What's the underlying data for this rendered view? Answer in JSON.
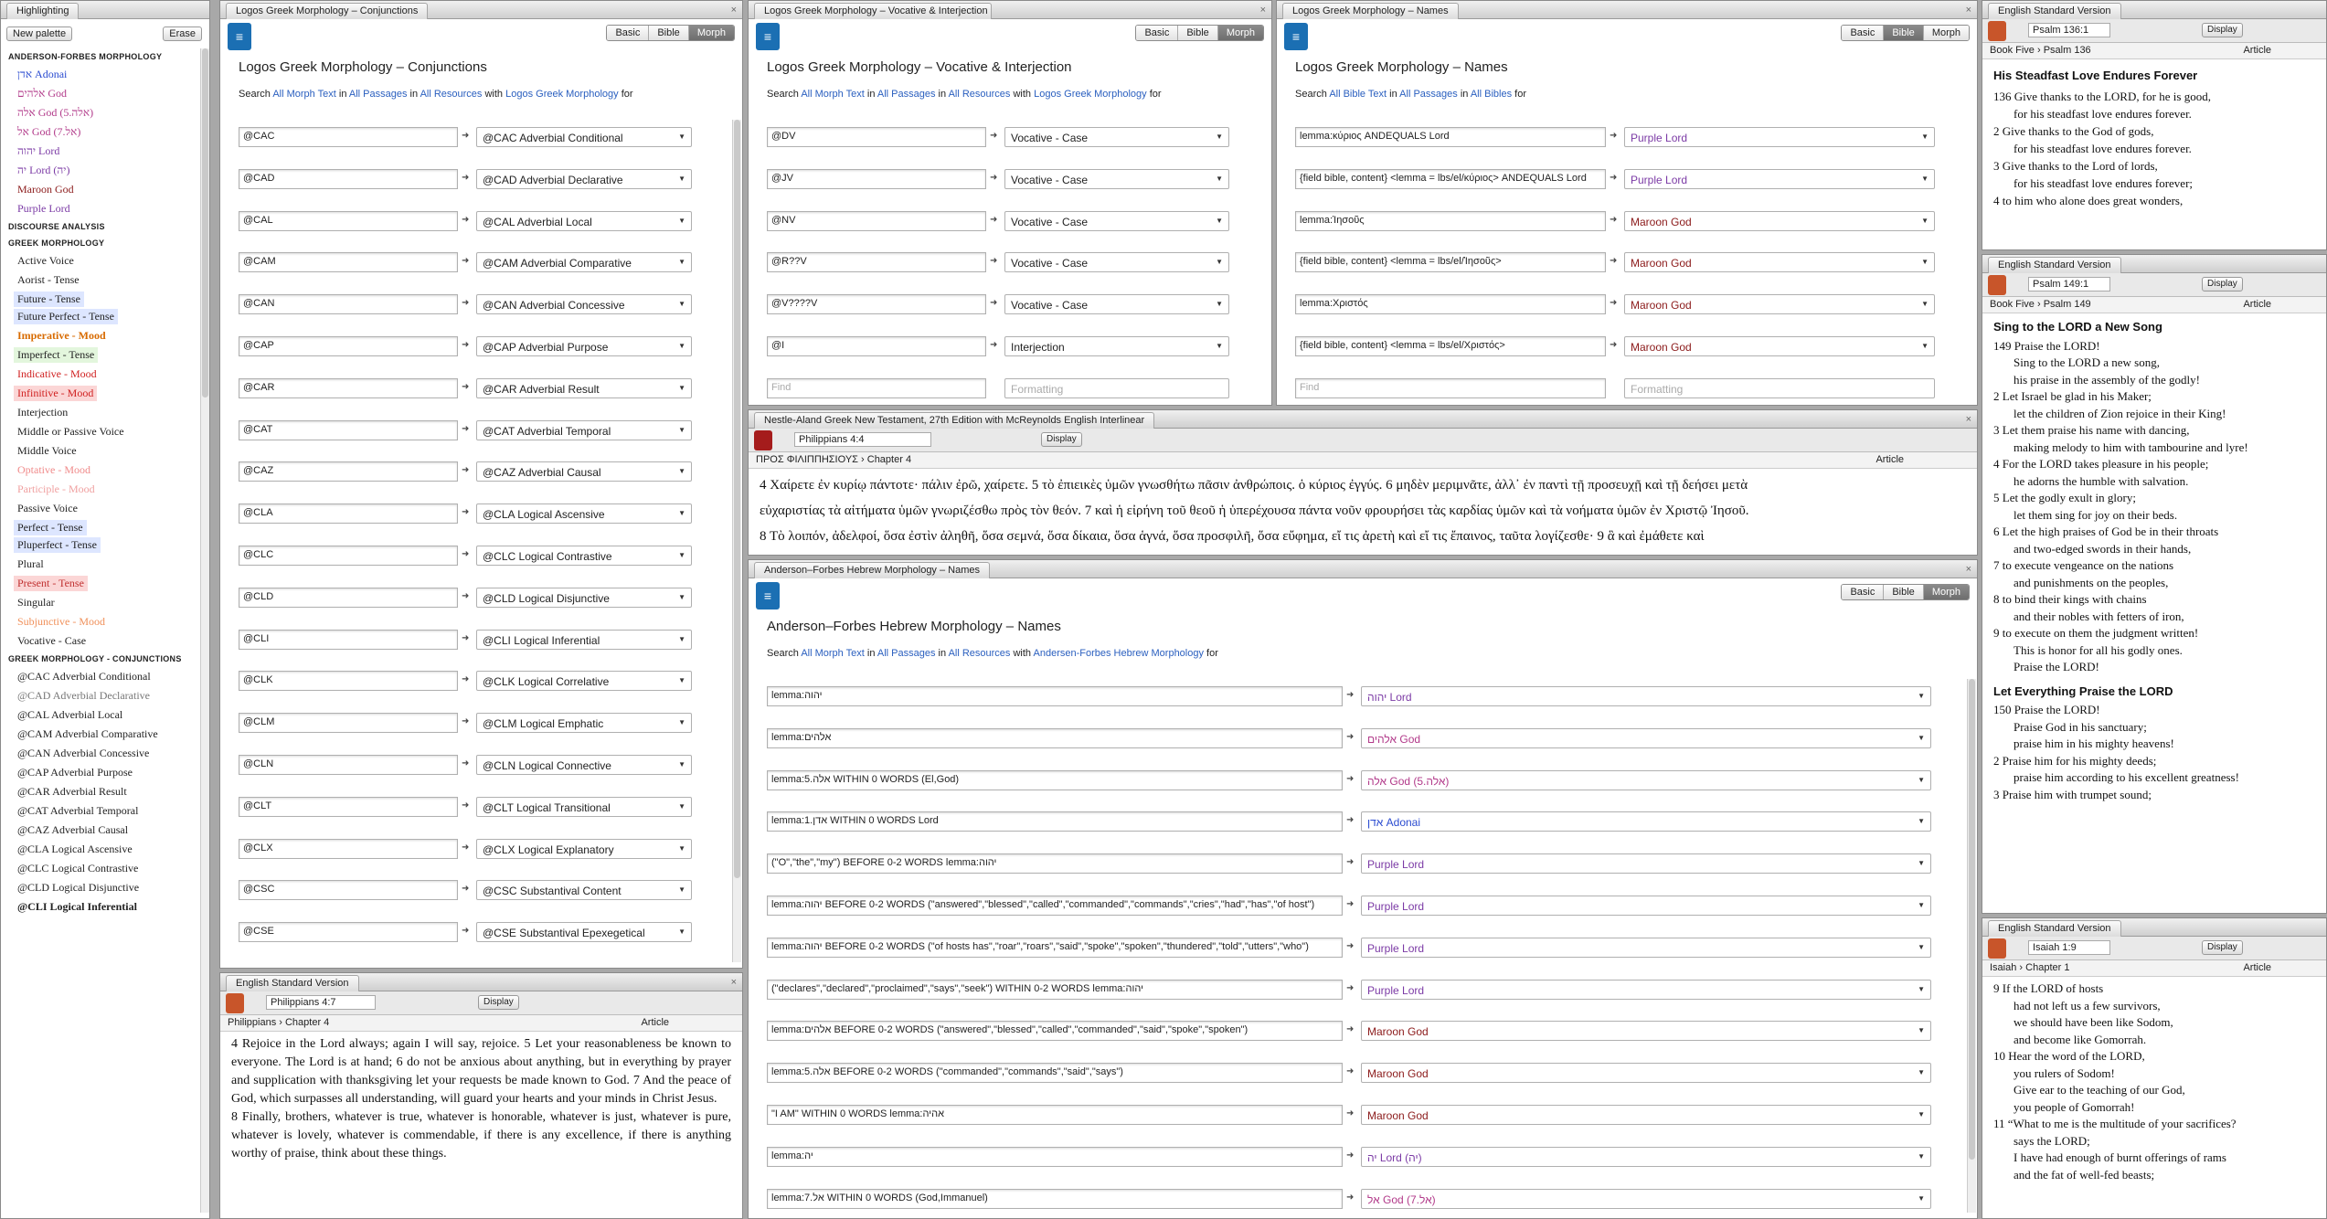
{
  "sidebar": {
    "title": "Highlighting",
    "new_btn": "New palette",
    "erase_btn": "Erase",
    "sections": [
      {
        "head": "ANDERSON-FORBES MORPHOLOGY",
        "items": [
          {
            "t": "אדן Adonai",
            "c": "#2a4bd0"
          },
          {
            "t": "אלהים God",
            "c": "#b23a8a"
          },
          {
            "t": "אלה God (5.אלה)",
            "c": "#b23a8a"
          },
          {
            "t": "אל God (7.אל)",
            "c": "#b23a8a"
          },
          {
            "t": "יהוה Lord",
            "c": "#7b3aa5"
          },
          {
            "t": "יה Lord (יה)",
            "c": "#7b3aa5"
          },
          {
            "t": "Maroon God",
            "c": "#8b1a1a"
          },
          {
            "t": "Purple Lord",
            "c": "#7b3aa5"
          }
        ]
      },
      {
        "head": "DISCOURSE ANALYSIS",
        "items": []
      },
      {
        "head": "GREEK MORPHOLOGY",
        "items": [
          {
            "t": "Active Voice",
            "c": "#222"
          },
          {
            "t": "Aorist - Tense",
            "c": "#222"
          },
          {
            "t": "Future - Tense",
            "c": "#222",
            "bg": "#dde6ff"
          },
          {
            "t": "Future Perfect - Tense",
            "c": "#222",
            "bg": "#dde6ff"
          },
          {
            "t": "Imperative - Mood",
            "c": "#d86b00",
            "b": true
          },
          {
            "t": "Imperfect - Tense",
            "c": "#222",
            "bg": "#e3f6dd"
          },
          {
            "t": "Indicative - Mood",
            "c": "#d02020"
          },
          {
            "t": "Infinitive - Mood",
            "c": "#d02020",
            "bg": "#fbd6d6"
          },
          {
            "t": "Interjection",
            "c": "#222"
          },
          {
            "t": "Middle or Passive Voice",
            "c": "#222"
          },
          {
            "t": "Middle Voice",
            "c": "#222"
          },
          {
            "t": "Optative - Mood",
            "c": "#f08a8a"
          },
          {
            "t": "Participle - Mood",
            "c": "#f0a0a0"
          },
          {
            "t": "Passive Voice",
            "c": "#222"
          },
          {
            "t": "Perfect - Tense",
            "c": "#222",
            "bg": "#dde6ff"
          },
          {
            "t": "Pluperfect - Tense",
            "c": "#222",
            "bg": "#dde6ff"
          },
          {
            "t": "Plural",
            "c": "#222"
          },
          {
            "t": "Present - Tense",
            "c": "#c03030",
            "bg": "#fbd6d6"
          },
          {
            "t": "Singular",
            "c": "#222"
          },
          {
            "t": "Subjunctive - Mood",
            "c": "#f0905a"
          },
          {
            "t": "Vocative - Case",
            "c": "#222"
          }
        ]
      },
      {
        "head": "GREEK MORPHOLOGY - CONJUNCTIONS",
        "items": [
          {
            "t": "@CAC Adverbial Conditional",
            "c": "#222"
          },
          {
            "t": "@CAD Adverbial Declarative",
            "c": "#777"
          },
          {
            "t": "@CAL Adverbial Local",
            "c": "#222"
          },
          {
            "t": "@CAM Adverbial Comparative",
            "c": "#222"
          },
          {
            "t": "@CAN Adverbial Concessive",
            "c": "#222"
          },
          {
            "t": "@CAP Adverbial Purpose",
            "c": "#222"
          },
          {
            "t": "@CAR Adverbial Result",
            "c": "#222"
          },
          {
            "t": "@CAT Adverbial Temporal",
            "c": "#222"
          },
          {
            "t": "@CAZ Adverbial Causal",
            "c": "#222"
          },
          {
            "t": "@CLA Logical Ascensive",
            "c": "#222"
          },
          {
            "t": "@CLC Logical Contrastive",
            "c": "#222"
          },
          {
            "t": "@CLD Logical Disjunctive",
            "c": "#222"
          },
          {
            "t": "@CLI Logical Inferential",
            "c": "#222",
            "b": true
          }
        ]
      }
    ]
  },
  "conj": {
    "tab": "Logos Greek Morphology – Conjunctions",
    "title": "Logos Greek Morphology – Conjunctions",
    "modes": [
      "Basic",
      "Bible",
      "Morph"
    ],
    "search": [
      "Search",
      "All Morph Text",
      "in",
      "All Passages",
      "in",
      "All Resources",
      "with",
      "Logos Greek Morphology",
      "for"
    ],
    "rows": [
      [
        "@CAC",
        "@CAC Adverbial Conditional"
      ],
      [
        "@CAD",
        "@CAD Adverbial Declarative"
      ],
      [
        "@CAL",
        "@CAL Adverbial Local"
      ],
      [
        "@CAM",
        "@CAM Adverbial Comparative"
      ],
      [
        "@CAN",
        "@CAN Adverbial Concessive"
      ],
      [
        "@CAP",
        "@CAP Adverbial Purpose"
      ],
      [
        "@CAR",
        "@CAR Adverbial Result"
      ],
      [
        "@CAT",
        "@CAT Adverbial Temporal"
      ],
      [
        "@CAZ",
        "@CAZ Adverbial Causal"
      ],
      [
        "@CLA",
        "@CLA Logical Ascensive"
      ],
      [
        "@CLC",
        "@CLC Logical Contrastive"
      ],
      [
        "@CLD",
        "@CLD Logical Disjunctive"
      ],
      [
        "@CLI",
        "@CLI Logical Inferential"
      ],
      [
        "@CLK",
        "@CLK Logical Correlative"
      ],
      [
        "@CLM",
        "@CLM Logical Emphatic"
      ],
      [
        "@CLN",
        "@CLN Logical Connective"
      ],
      [
        "@CLT",
        "@CLT Logical Transitional"
      ],
      [
        "@CLX",
        "@CLX Logical Explanatory"
      ],
      [
        "@CSC",
        "@CSC Substantival Content"
      ],
      [
        "@CSE",
        "@CSE Substantival Epexegetical"
      ]
    ]
  },
  "voc": {
    "tab": "Logos Greek Morphology – Vocative & Interjection",
    "title": "Logos Greek Morphology – Vocative & Interjection",
    "search": [
      "Search",
      "All Morph Text",
      "in",
      "All Passages",
      "in",
      "All Resources",
      "with",
      "Logos Greek Morphology",
      "for"
    ],
    "rows": [
      [
        "@DV",
        "Vocative - Case"
      ],
      [
        "@JV",
        "Vocative - Case"
      ],
      [
        "@NV",
        "Vocative - Case"
      ],
      [
        "@R??V",
        "Vocative - Case"
      ],
      [
        "@V????V",
        "Vocative - Case"
      ],
      [
        "@I",
        "Interjection"
      ]
    ],
    "find": "Find",
    "fmt": "Formatting"
  },
  "names": {
    "tab": "Logos Greek Morphology – Names",
    "title": "Logos Greek Morphology – Names",
    "search": [
      "Search",
      "All Bible Text",
      "in",
      "All Passages",
      "in",
      "All Bibles",
      "for"
    ],
    "rows": [
      [
        "lemma:κύριος ANDEQUALS Lord",
        "Purple Lord",
        "#7b3aa5"
      ],
      [
        "{field bible, content} <lemma = lbs/el/κύριος> ANDEQUALS Lord",
        "Purple Lord",
        "#7b3aa5"
      ],
      [
        "lemma:Ἰησοῦς",
        "Maroon God",
        "#8b1a1a"
      ],
      [
        "{field bible, content} <lemma = lbs/el/Ἰησοῦς>",
        "Maroon God",
        "#8b1a1a"
      ],
      [
        "lemma:Χριστός",
        "Maroon God",
        "#8b1a1a"
      ],
      [
        "{field bible, content} <lemma = lbs/el/Χριστός>",
        "Maroon God",
        "#8b1a1a"
      ]
    ],
    "find": "Find",
    "fmt": "Formatting"
  },
  "na27": {
    "tab": "Nestle-Aland Greek New Testament, 27th Edition with McReynolds English Interlinear",
    "ref": "Philippians 4:4",
    "display": "Display",
    "book": "ΠΡΟΣ ΦΙΛΙΠΠΗΣΙΟΥΣ",
    "chapter": "Chapter 4",
    "view": "Article",
    "line1": "4 Χαίρετε ἐν κυρίῳ πάντοτε· πάλιν ἐρῶ, χαίρετε. 5 τὸ ἐπιεικὲς ὑμῶν γνωσθήτω πᾶσιν ἀνθρώποις. ὁ κύριος ἐγγύς. 6 μηδὲν μεριμνᾶτε, ἀλλ᾽ ἐν παντὶ τῇ προσευχῇ καὶ τῇ δεήσει μετὰ",
    "line2": "εὐχαριστίας τὰ αἰτήματα ὑμῶν γνωριζέσθω πρὸς τὸν θεόν. 7 καὶ ἡ εἰρήνη τοῦ θεοῦ ἡ ὑπερέχουσα πάντα νοῦν φρουρήσει τὰς καρδίας ὑμῶν καὶ τὰ νοήματα ὑμῶν ἐν Χριστῷ Ἰησοῦ.",
    "line3": "8 Τὸ λοιπόν, ἀδελφοί, ὅσα ἐστὶν ἀληθῆ, ὅσα σεμνά, ὅσα δίκαια, ὅσα ἁγνά, ὅσα προσφιλῆ, ὅσα εὔφημα, εἴ τις ἀρετὴ καὶ εἴ τις ἔπαινος, ταῦτα λογίζεσθε· 9 ἃ καὶ ἐμάθετε καὶ"
  },
  "heb": {
    "tab": "Anderson–Forbes Hebrew Morphology – Names",
    "title": "Anderson–Forbes Hebrew Morphology – Names",
    "search": [
      "Search",
      "All Morph Text",
      "in",
      "All Passages",
      "in",
      "All Resources",
      "with",
      "Andersen-Forbes Hebrew Morphology",
      "for"
    ],
    "rows": [
      [
        "lemma:יהוה",
        "יהוה Lord",
        "#7b3aa5"
      ],
      [
        "lemma:אלהים",
        "אלהים God",
        "#b23a8a"
      ],
      [
        "lemma:5.אלה WITHIN 0 WORDS (El,God)",
        "אלה God (5.אלה)",
        "#b23a8a"
      ],
      [
        "lemma:1.אדן WITHIN 0 WORDS Lord",
        "אדן Adonai",
        "#2a4bd0"
      ],
      [
        "(\"O\",\"the\",\"my\") BEFORE 0-2 WORDS lemma:יהוה",
        "Purple Lord",
        "#7b3aa5"
      ],
      [
        "lemma:יהוה BEFORE 0-2 WORDS (\"answered\",\"blessed\",\"called\",\"commanded\",\"commands\",\"cries\",\"had\",\"has\",\"of host\")",
        "Purple Lord",
        "#7b3aa5"
      ],
      [
        "lemma:יהוה BEFORE 0-2 WORDS (\"of hosts has\",\"roar\",\"roars\",\"said\",\"spoke\",\"spoken\",\"thundered\",\"told\",\"utters\",\"who\")",
        "Purple Lord",
        "#7b3aa5"
      ],
      [
        "(\"declares\",\"declared\",\"proclaimed\",\"says\",\"seek\") WITHIN 0-2 WORDS lemma:יהוה",
        "Purple Lord",
        "#7b3aa5"
      ],
      [
        "lemma:אלהים BEFORE 0-2 WORDS (\"answered\",\"blessed\",\"called\",\"commanded\",\"said\",\"spoke\",\"spoken\")",
        "Maroon God",
        "#8b1a1a"
      ],
      [
        "lemma:5.אלה BEFORE 0-2 WORDS (\"commanded\",\"commands\",\"said\",\"says\")",
        "Maroon God",
        "#8b1a1a"
      ],
      [
        "\"I AM\" WITHIN 0 WORDS lemma:אהיה",
        "Maroon God",
        "#8b1a1a"
      ],
      [
        "lemma:יה",
        "יה Lord (יה)",
        "#7b3aa5"
      ],
      [
        "lemma:7.אל WITHIN 0 WORDS (God,Immanuel)",
        "אל God (7.אל)",
        "#b23a8a"
      ]
    ]
  },
  "esv_phil": {
    "tab": "English Standard Version",
    "ref": "Philippians 4:7",
    "display": "Display",
    "book": "Philippians",
    "chapter": "Chapter 4",
    "view": "Article",
    "text": "4 Rejoice in the Lord always; again I will say, rejoice. 5 Let your reasonableness be known to everyone. The Lord is at hand; 6 do not be anxious about anything, but in everything by prayer and supplication with thanksgiving let your requests be made known to God. 7 And the peace of God, which surpasses all understanding, will guard your hearts and your minds in Christ Jesus.",
    "text2": "8 Finally, brothers, whatever is true, whatever is honorable, whatever is just, whatever is pure, whatever is lovely, whatever is commendable, if there is any excellence, if there is anything worthy of praise, think about these things."
  },
  "esv136": {
    "tab": "English Standard Version",
    "ref": "Psalm 136:1",
    "display": "Display",
    "book": "Book Five",
    "chapter": "Psalm 136",
    "view": "Article",
    "heading": "His Steadfast Love Endures Forever",
    "lines": [
      "136 Give thanks to the LORD, for he is good,",
      "for his steadfast love endures forever.",
      "2 Give thanks to the God of gods,",
      "for his steadfast love endures forever.",
      "3 Give thanks to the Lord of lords,",
      "for his steadfast love endures forever;",
      "4 to him who alone does great wonders,"
    ]
  },
  "esv149": {
    "tab": "English Standard Version",
    "ref": "Psalm 149:1",
    "display": "Display",
    "book": "Book Five",
    "chapter": "Psalm 149",
    "view": "Article",
    "heading": "Sing to the LORD a New Song",
    "lines": [
      "149 Praise the LORD!",
      "Sing to the LORD a new song,",
      "his praise in the assembly of the godly!",
      "2 Let Israel be glad in his Maker;",
      "let the children of Zion rejoice in their King!",
      "3 Let them praise his name with dancing,",
      "making melody to him with tambourine and lyre!",
      "4 For the LORD takes pleasure in his people;",
      "he adorns the humble with salvation.",
      "5 Let the godly exult in glory;",
      "let them sing for joy on their beds.",
      "6 Let the high praises of God be in their throats",
      "and two-edged swords in their hands,",
      "7 to execute vengeance on the nations",
      "and punishments on the peoples,",
      "8 to bind their kings with chains",
      "and their nobles with fetters of iron,",
      "9 to execute on them the judgment written!",
      "This is honor for all his godly ones.",
      "Praise the LORD!"
    ],
    "heading2": "Let Everything Praise the LORD",
    "lines2": [
      "150 Praise the LORD!",
      "Praise God in his sanctuary;",
      "praise him in his mighty heavens!",
      "2 Praise him for his mighty deeds;",
      "praise him according to his excellent greatness!",
      "3 Praise him with trumpet sound;"
    ]
  },
  "esv_isa": {
    "tab": "English Standard Version",
    "ref": "Isaiah 1:9",
    "display": "Display",
    "book": "Isaiah",
    "chapter": "Chapter 1",
    "view": "Article",
    "lines": [
      "9 If the LORD of hosts",
      "had not left us a few survivors,",
      "we should have been like Sodom,",
      "and become like Gomorrah.",
      "10 Hear the word of the LORD,",
      "you rulers of Sodom!",
      "Give ear to the teaching of our God,",
      "you people of Gomorrah!",
      "11 “What to me is the multitude of your sacrifices?",
      "says the LORD;",
      "I have had enough of burnt offerings of rams",
      "and the fat of well-fed beasts;"
    ]
  }
}
